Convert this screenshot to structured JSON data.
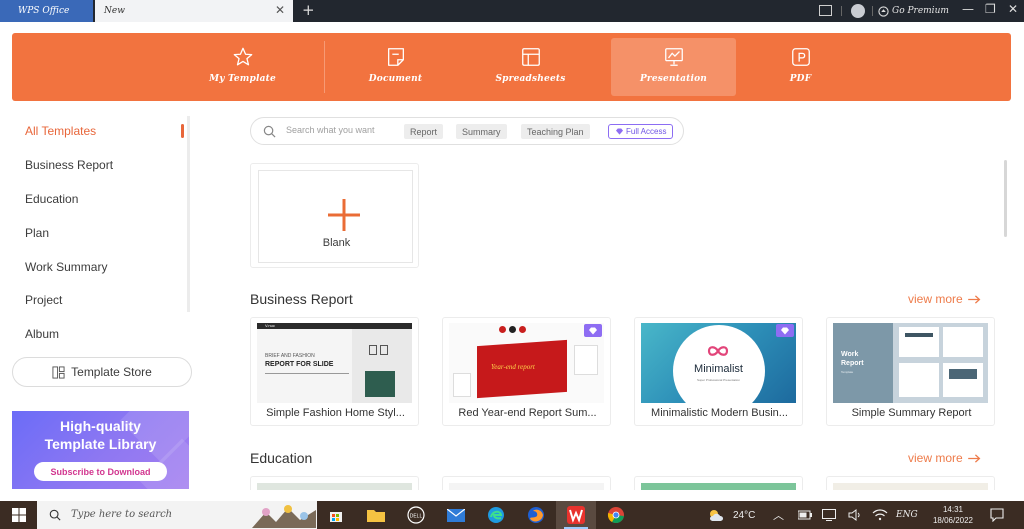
{
  "titlebar": {
    "app_tab": "WPS Office",
    "doc_tab": "New",
    "close_glyph": "✕",
    "new_tab_glyph": "+",
    "premium_label": "Go Premium",
    "minimize_glyph": "—",
    "restore_glyph": "❐",
    "close_window_glyph": "✕"
  },
  "categories": [
    {
      "label": "My Template",
      "icon": "star-icon"
    },
    {
      "label": "Document",
      "icon": "document-icon"
    },
    {
      "label": "Spreadsheets",
      "icon": "spreadsheet-icon"
    },
    {
      "label": "Presentation",
      "icon": "presentation-icon",
      "active": true
    },
    {
      "label": "PDF",
      "icon": "pdf-icon"
    }
  ],
  "sidebar": {
    "items": [
      {
        "label": "All Templates",
        "active": true
      },
      {
        "label": "Business Report"
      },
      {
        "label": "Education"
      },
      {
        "label": "Plan"
      },
      {
        "label": "Work Summary"
      },
      {
        "label": "Project"
      },
      {
        "label": "Album"
      }
    ],
    "store_label": "Template Store"
  },
  "promo": {
    "line1": "High-quality",
    "line2": "Template Library",
    "button": "Subscribe to Download"
  },
  "search": {
    "placeholder": "Search what you want",
    "chips": [
      "Report",
      "Summary",
      "Teaching Plan"
    ],
    "full_access": "Full Access"
  },
  "blank": {
    "label": "Blank"
  },
  "sections": {
    "business": {
      "title": "Business Report",
      "view_more": "view more",
      "templates": [
        {
          "caption": "Simple Fashion Home Styl...",
          "thumb_line1": "BRIEF AND FASHION",
          "thumb_line2": "REPORT FOR SLIDE",
          "brand": "V.nuc",
          "premium": false
        },
        {
          "caption": "Red Year-end Report Sum...",
          "thumb_line1": "Year-end report",
          "premium": true
        },
        {
          "caption": "Minimalistic Modern Busin...",
          "thumb_line1": "Minimalist",
          "thumb_line2": "Super Professional Presentation",
          "premium": true
        },
        {
          "caption": "Simple Summary Report",
          "thumb_line1": "Work",
          "thumb_line2": "Report",
          "thumb_line3": "Template",
          "premium": false
        }
      ]
    },
    "education": {
      "title": "Education",
      "view_more": "view more"
    }
  },
  "taskbar": {
    "search_text": "Type here to search",
    "weather": "24°C",
    "language": "ENG",
    "time": "14:31",
    "date": "18/06/2022"
  },
  "colors": {
    "accent": "#f2733f",
    "accent_text": "#e8663a",
    "premium_purple": "#8e6df3"
  }
}
